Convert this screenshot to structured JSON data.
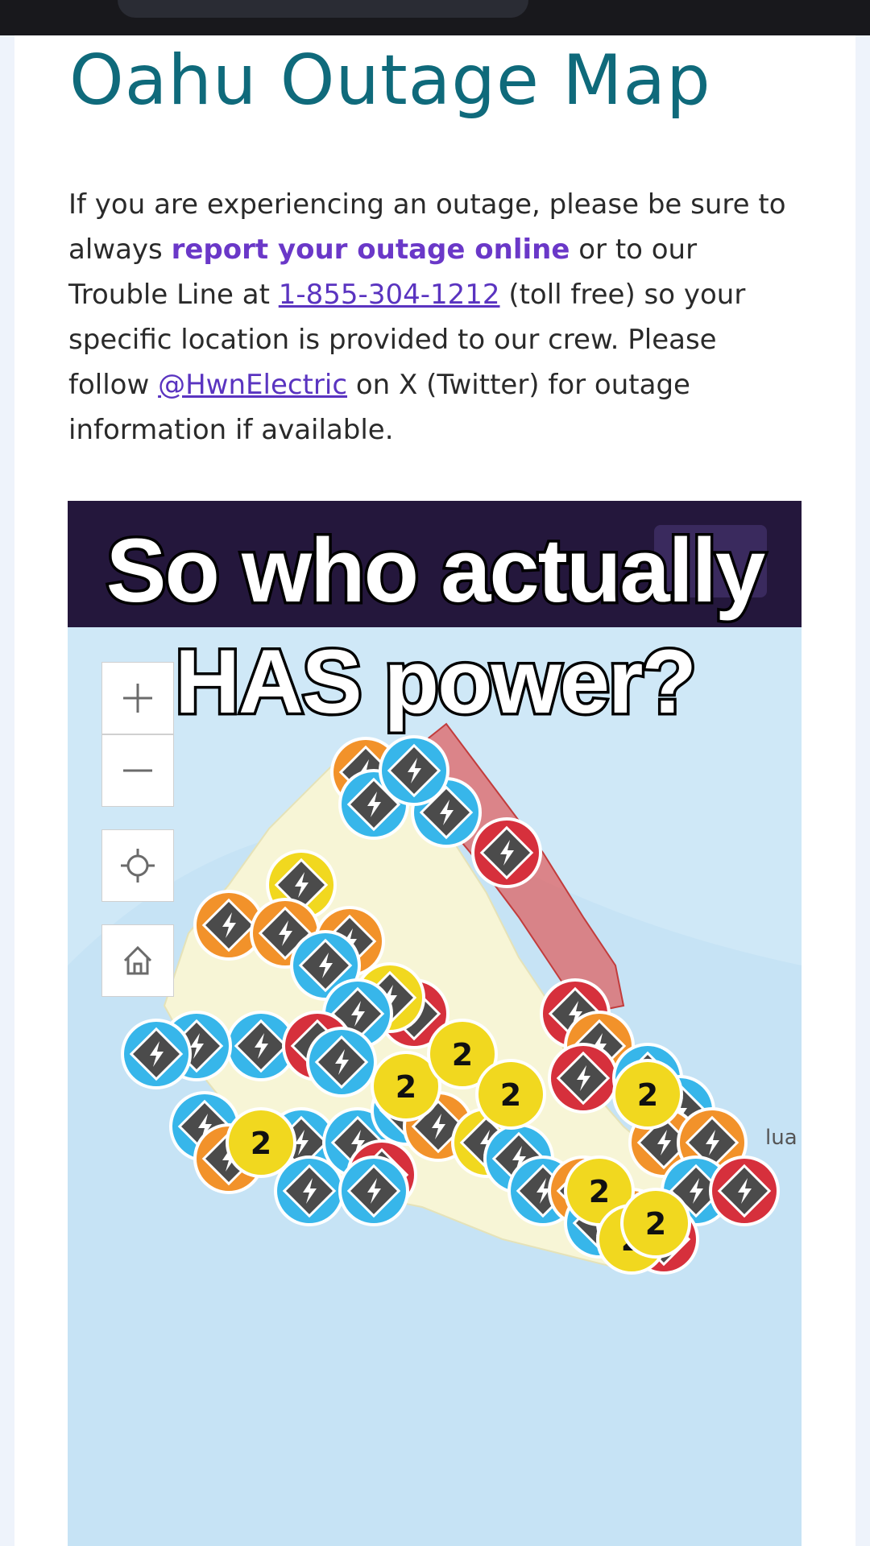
{
  "page": {
    "title": "Oahu Outage Map",
    "intro": {
      "text1": "If you are experiencing an outage, please be sure to always ",
      "link_report": "report your outage online",
      "text2": " or to our Trouble Line at ",
      "phone": "1-855-304-1212",
      "text3": " (toll free) so your specific location is provided to our crew. Please follow ",
      "twitter": "@HwnElectric",
      "text4": " on X (Twitter) for outage information if available."
    }
  },
  "map": {
    "controls": {
      "zoom_in_icon": "plus-icon",
      "zoom_out_icon": "minus-icon",
      "locate_icon": "crosshair-icon",
      "home_icon": "home-icon"
    },
    "place_label": "lua",
    "marker_count_label": "2",
    "marker_icon": "lightning-bolt-icon",
    "colors": {
      "header": "#24173c",
      "ocean": "#cfe8f7",
      "land": "#f7f5d6",
      "outage_area": "#e05a5a",
      "marker_blue": "#37b6ea",
      "marker_orange": "#f2922a",
      "marker_yellow": "#f1d81f",
      "marker_red": "#d6303c",
      "marker_core": "#4b4b4b"
    }
  },
  "overlay": {
    "caption_line1": "So who actually",
    "caption_line2": "HAS power?"
  }
}
